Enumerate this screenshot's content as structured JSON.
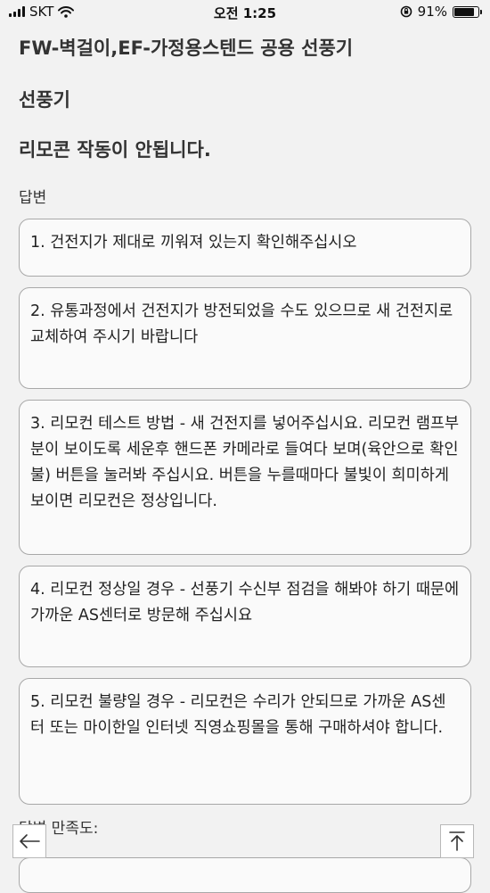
{
  "status_bar": {
    "carrier": "SKT",
    "time": "오전 1:25",
    "battery_percent": "91%",
    "battery_level": 0.91
  },
  "faq": {
    "product": "FW-벽걸이,EF-가정용스텐드 공용 선풍기",
    "category": "선풍기",
    "question": "리모콘 작동이 안됩니다.",
    "answer_label": "답변",
    "answers": [
      "1. 건전지가 제대로 끼워져 있는지 확인해주십시오",
      "2. 유통과정에서 건전지가 방전되었을 수도 있으므로 새 건전지로 교체하여 주시기 바랍니다",
      "3. 리모컨 테스트 방법 - 새 건전지를 넣어주십시요. 리모컨 램프부분이 보이도록 세운후 핸드폰 카메라로 들여다 보며(육안으로 확인불) 버튼을 눌러봐 주십시요. 버튼을 누를때마다 불빛이 희미하게 보이면 리모컨은 정상입니다.",
      "4. 리모컨 정상일 경우 - 선풍기 수신부 점검을 해봐야 하기 때문에 가까운 AS센터로 방문해 주십시요",
      "5. 리모컨 불량일 경우 - 리모컨은 수리가 안되므로 가까운 AS센터 또는 마이한일 인터넷 직영쇼핑몰을 통해 구매하셔야 합니다."
    ],
    "satisfaction_label": "답변 만족도:"
  },
  "icons": {
    "back": "arrow-left-icon",
    "top": "arrow-up-icon"
  }
}
